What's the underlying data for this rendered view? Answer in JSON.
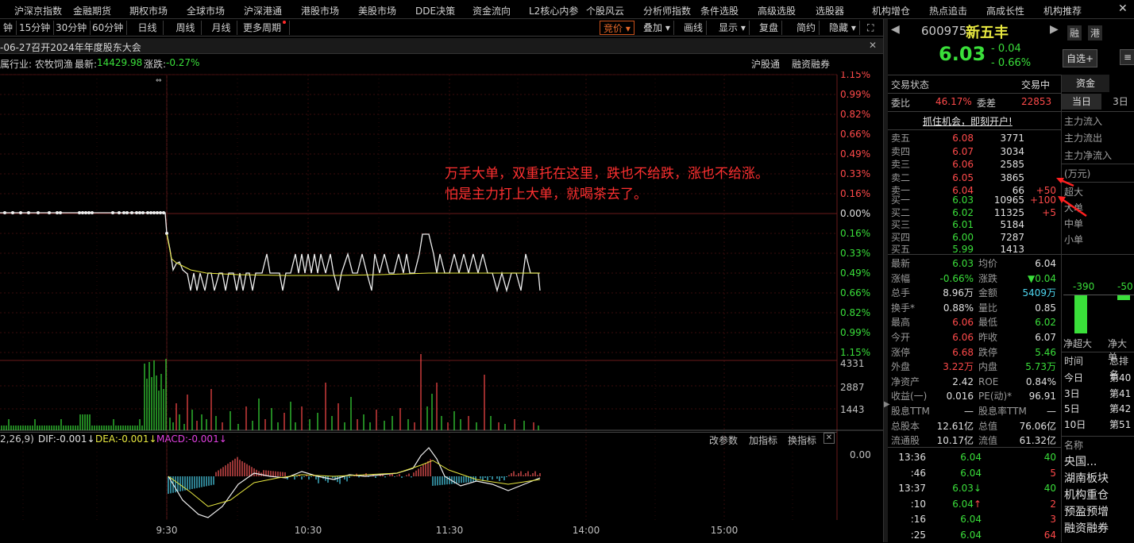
{
  "menu": [
    "沪深京指数",
    "金融期货",
    "期权市场",
    "全球市场",
    "沪深港通",
    "港股市场",
    "美股市场",
    "DDE决策",
    "资金流向",
    "L2核心内参",
    "个股风云",
    "分析师指数",
    "条件选股",
    "高级选股",
    "选股器",
    "机构增仓",
    "热点追击",
    "高成长性",
    "机构推荐"
  ],
  "toolbar": {
    "periods": [
      "钟",
      "15分钟",
      "30分钟",
      "60分钟",
      "日线",
      "周线",
      "月线",
      "更多周期"
    ],
    "right": [
      "竞价",
      "叠加",
      "画线",
      "显示",
      "复盘",
      "简约",
      "隐藏"
    ]
  },
  "news_bar": "-06-27召开2024年年度股东大会",
  "info_bar": {
    "industry": "属行业: 农牧饲渔",
    "latest_label": "最新:",
    "latest": "14429.98",
    "change_label": "涨跌:",
    "change": "-0.27%",
    "hgt": "沪股通",
    "rzrq": "融资融券"
  },
  "price_axis": [
    "1.15%",
    "0.99%",
    "0.82%",
    "0.66%",
    "0.49%",
    "0.33%",
    "0.16%",
    "0.00%",
    "0.16%",
    "0.33%",
    "0.49%",
    "0.66%",
    "0.82%",
    "0.99%",
    "1.15%"
  ],
  "volume_axis": [
    "4331",
    "2887",
    "1443"
  ],
  "macd_bar": {
    "params": "2,26,9)",
    "dif": "DIF:-0.001↓",
    "dea": "DEA:-0.001↓",
    "macd": "MACD:-0.001↓",
    "mod": "改参数",
    "add": "加指标",
    "switch": "换指标",
    "value": "0.00"
  },
  "time_axis": [
    "9:30",
    "10:30",
    "11:30",
    "14:00",
    "15:00"
  ],
  "annotation": [
    "万手大单，双重托在这里，跌也不给跌，涨也不给涨。",
    "怕是主力打上大单，就喝茶去了。"
  ],
  "stock": {
    "code": "600975",
    "name": "新五丰",
    "price": "6.03",
    "change": "- 0.04",
    "change_pct": "- 0.66%",
    "tag1": "融",
    "tag2": "港",
    "watch": "自选+"
  },
  "status": {
    "label": "交易状态",
    "value": "交易中",
    "wb_label": "委比",
    "wb": "46.17%",
    "wc_label": "委差",
    "wc": "22853",
    "promo": "抓住机会，即刻开户!"
  },
  "sells": [
    {
      "label": "卖五",
      "price": "6.08",
      "vol": "3771",
      "chg": ""
    },
    {
      "label": "卖四",
      "price": "6.07",
      "vol": "3034",
      "chg": ""
    },
    {
      "label": "卖三",
      "price": "6.06",
      "vol": "2585",
      "chg": ""
    },
    {
      "label": "卖二",
      "price": "6.05",
      "vol": "3865",
      "chg": ""
    },
    {
      "label": "卖一",
      "price": "6.04",
      "vol": "66",
      "chg": "+50"
    }
  ],
  "buys": [
    {
      "label": "买一",
      "price": "6.03",
      "vol": "10965",
      "chg": "+100"
    },
    {
      "label": "买二",
      "price": "6.02",
      "vol": "11325",
      "chg": "+5"
    },
    {
      "label": "买三",
      "price": "6.01",
      "vol": "5184",
      "chg": ""
    },
    {
      "label": "买四",
      "price": "6.00",
      "vol": "7287",
      "chg": ""
    },
    {
      "label": "买五",
      "price": "5.99",
      "vol": "1413",
      "chg": ""
    }
  ],
  "stats": [
    [
      "最新",
      "6.03",
      "均价",
      "6.04"
    ],
    [
      "涨幅",
      "-0.66%",
      "涨跌",
      "▼0.04"
    ],
    [
      "总手",
      "8.96万",
      "金额",
      "5409万"
    ],
    [
      "换手*",
      "0.88%",
      "量比",
      "0.85"
    ],
    [
      "最高",
      "6.06",
      "最低",
      "6.02"
    ],
    [
      "今开",
      "6.06",
      "昨收",
      "6.07"
    ],
    [
      "涨停",
      "6.68",
      "跌停",
      "5.46"
    ],
    [
      "外盘",
      "3.22万",
      "内盘",
      "5.73万"
    ],
    [
      "净资产",
      "2.42",
      "ROE",
      "0.84%"
    ],
    [
      "收益(一)",
      "0.016",
      "PE(动)*",
      "96.91"
    ],
    [
      "股息TTM",
      "—",
      "股息率TTM",
      "—"
    ],
    [
      "总股本",
      "12.61亿",
      "总值",
      "76.06亿"
    ],
    [
      "流通股",
      "10.17亿",
      "流值",
      "61.32亿"
    ]
  ],
  "ticks": [
    {
      "time": "13:36",
      "price": "6.04",
      "arrow": "",
      "vol": "40"
    },
    {
      "time": ":46",
      "price": "6.04",
      "arrow": "",
      "vol": "5"
    },
    {
      "time": "13:37",
      "price": "6.03",
      "arrow": "↓",
      "vol": "40"
    },
    {
      "time": ":10",
      "price": "6.04",
      "arrow": "↑",
      "vol": "2"
    },
    {
      "time": ":16",
      "price": "6.04",
      "arrow": "",
      "vol": "3"
    },
    {
      "time": ":25",
      "price": "6.04",
      "arrow": "",
      "vol": "64"
    }
  ],
  "fund": {
    "tab": "资金",
    "today": "当日",
    "d3": "3日",
    "flows": [
      "主力流入",
      "主力流出",
      "主力净流入"
    ],
    "unit": "(万元)",
    "sizes": [
      "超大",
      "大单",
      "中单",
      "小单"
    ],
    "bar_values": [
      "-390",
      "-50"
    ],
    "bar_labels": [
      "净超大",
      "净大单"
    ],
    "rank_head": [
      "时间",
      "总排名"
    ],
    "rank": [
      [
        "今日",
        "第40"
      ],
      [
        "3日",
        "第41"
      ],
      [
        "5日",
        "第42"
      ],
      [
        "10日",
        "第51"
      ]
    ],
    "name_head": "名称",
    "tags": [
      "央国...",
      "湖南板块",
      "机构重仓",
      "预盈预增",
      "融资融券"
    ]
  }
}
